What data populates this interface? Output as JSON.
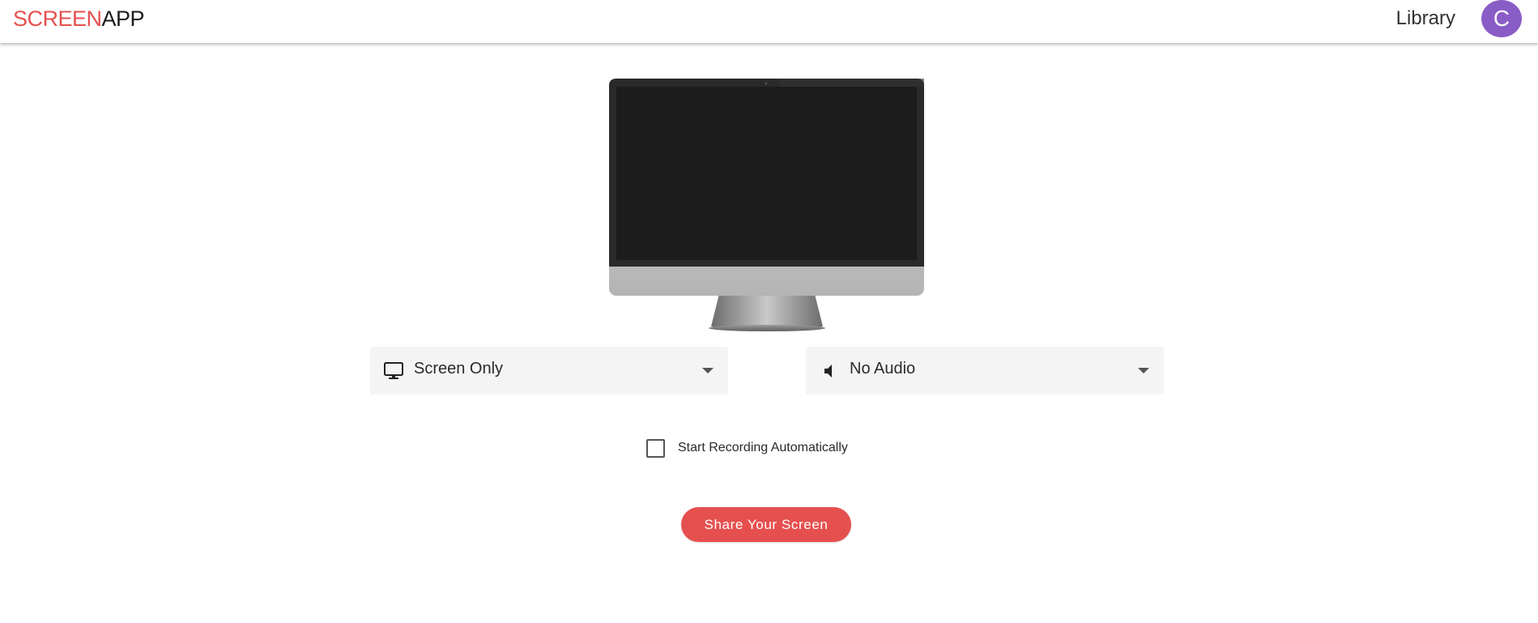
{
  "header": {
    "logo_part1": "SCREEN",
    "logo_part2": "APP",
    "library_label": "Library",
    "avatar_initial": "C"
  },
  "video_select": {
    "icon": "monitor-icon",
    "selected": "Screen Only"
  },
  "audio_select": {
    "icon": "speaker-icon",
    "selected": "No Audio"
  },
  "auto_record": {
    "label": "Start Recording Automatically",
    "checked": false
  },
  "share_button": {
    "label": "Share Your Screen"
  },
  "colors": {
    "brand_red": "#e5504f",
    "avatar_purple": "#8a5cc6",
    "select_bg": "#f4f4f4"
  }
}
